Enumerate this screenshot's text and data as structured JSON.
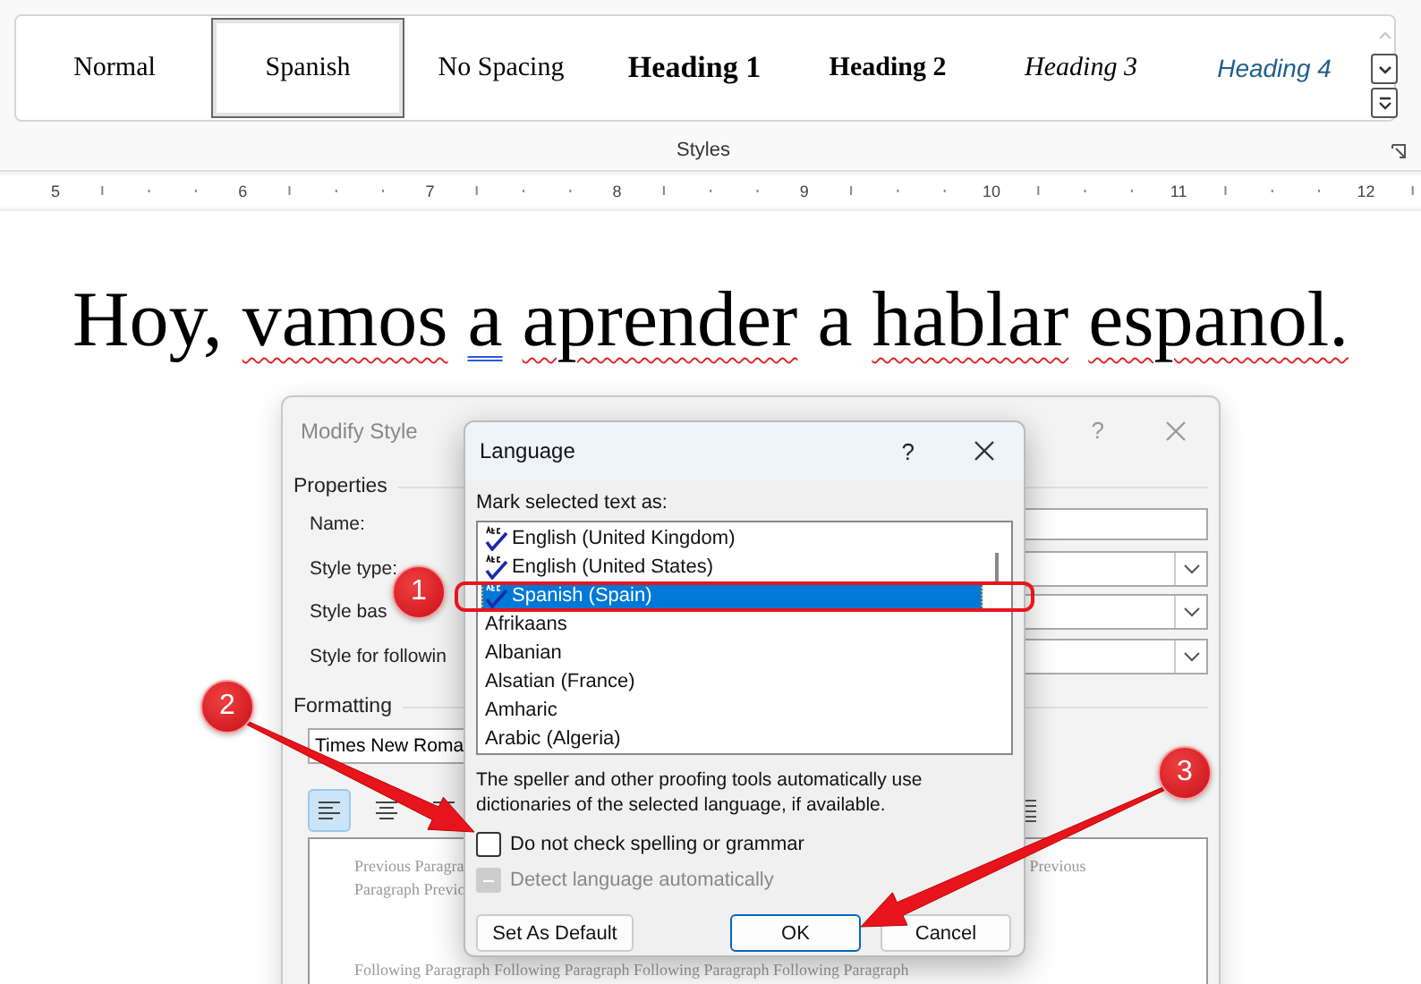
{
  "ribbon": {
    "styles": [
      {
        "label": "Normal",
        "kind": "normal",
        "selected": false
      },
      {
        "label": "Spanish",
        "kind": "normal",
        "selected": true
      },
      {
        "label": "No Spacing",
        "kind": "normal",
        "selected": false
      },
      {
        "label": "Heading 1",
        "kind": "heading1",
        "selected": false
      },
      {
        "label": "Heading 2",
        "kind": "heading2",
        "selected": false
      },
      {
        "label": "Heading 3",
        "kind": "heading3",
        "selected": false
      },
      {
        "label": "Heading 4",
        "kind": "heading4",
        "selected": false
      }
    ],
    "group_label": "Styles"
  },
  "ruler": {
    "numbers": [
      "5",
      "6",
      "7",
      "8",
      "9",
      "10",
      "11",
      "12"
    ]
  },
  "document": {
    "words": [
      {
        "text": "Hoy,",
        "kind": "plain"
      },
      {
        "text": "vamos",
        "kind": "spelling"
      },
      {
        "text": "a",
        "kind": "grammar"
      },
      {
        "text": "aprender",
        "kind": "spelling"
      },
      {
        "text": "a",
        "kind": "plain"
      },
      {
        "text": "hablar",
        "kind": "spelling"
      },
      {
        "text": "espanol.",
        "kind": "spelling"
      }
    ]
  },
  "modify_style_dialog": {
    "title": "Modify Style",
    "help": "?",
    "properties_label": "Properties",
    "fields": [
      {
        "label": "Name:",
        "kind": "text"
      },
      {
        "label": "Style type:",
        "kind": "dropdown"
      },
      {
        "label": "Style bas",
        "kind": "dropdown"
      },
      {
        "label": "Style for followin",
        "kind": "dropdown"
      }
    ],
    "formatting_label": "Formatting",
    "font": "Times New Roma",
    "alignment": [
      {
        "selected": true
      },
      {
        "selected": false
      },
      {
        "selected": false
      }
    ],
    "preview": {
      "previous_left": [
        "Previous Paragra",
        "Paragraph Previo"
      ],
      "previous_right": "Previous",
      "following": "Following Paragraph Following Paragraph Following Paragraph Following Paragraph"
    }
  },
  "language_dialog": {
    "title": "Language",
    "help": "?",
    "list_label": "Mark selected text as:",
    "languages": [
      {
        "name": "English (United Kingdom)",
        "proofing": true,
        "selected": false
      },
      {
        "name": "English (United States)",
        "proofing": true,
        "selected": false
      },
      {
        "name": "Spanish (Spain)",
        "proofing": true,
        "selected": true
      },
      {
        "name": "Afrikaans",
        "proofing": false,
        "selected": false
      },
      {
        "name": "Albanian",
        "proofing": false,
        "selected": false
      },
      {
        "name": "Alsatian (France)",
        "proofing": false,
        "selected": false
      },
      {
        "name": "Amharic",
        "proofing": false,
        "selected": false
      },
      {
        "name": "Arabic (Algeria)",
        "proofing": false,
        "selected": false
      }
    ],
    "note": "The speller and other proofing tools automatically use dictionaries of the selected language, if available.",
    "options": [
      {
        "label": "Do not check spelling or grammar",
        "checked": false,
        "disabled": false,
        "mixed": false
      },
      {
        "label": "Detect language automatically",
        "checked": false,
        "disabled": true,
        "mixed": true
      }
    ],
    "buttons": [
      {
        "label": "Set As Default",
        "kind": "normal"
      },
      {
        "label": "OK",
        "kind": "default"
      },
      {
        "label": "Cancel",
        "kind": "normal"
      }
    ]
  },
  "annotations": [
    {
      "number": "1"
    },
    {
      "number": "2"
    },
    {
      "number": "3"
    }
  ]
}
